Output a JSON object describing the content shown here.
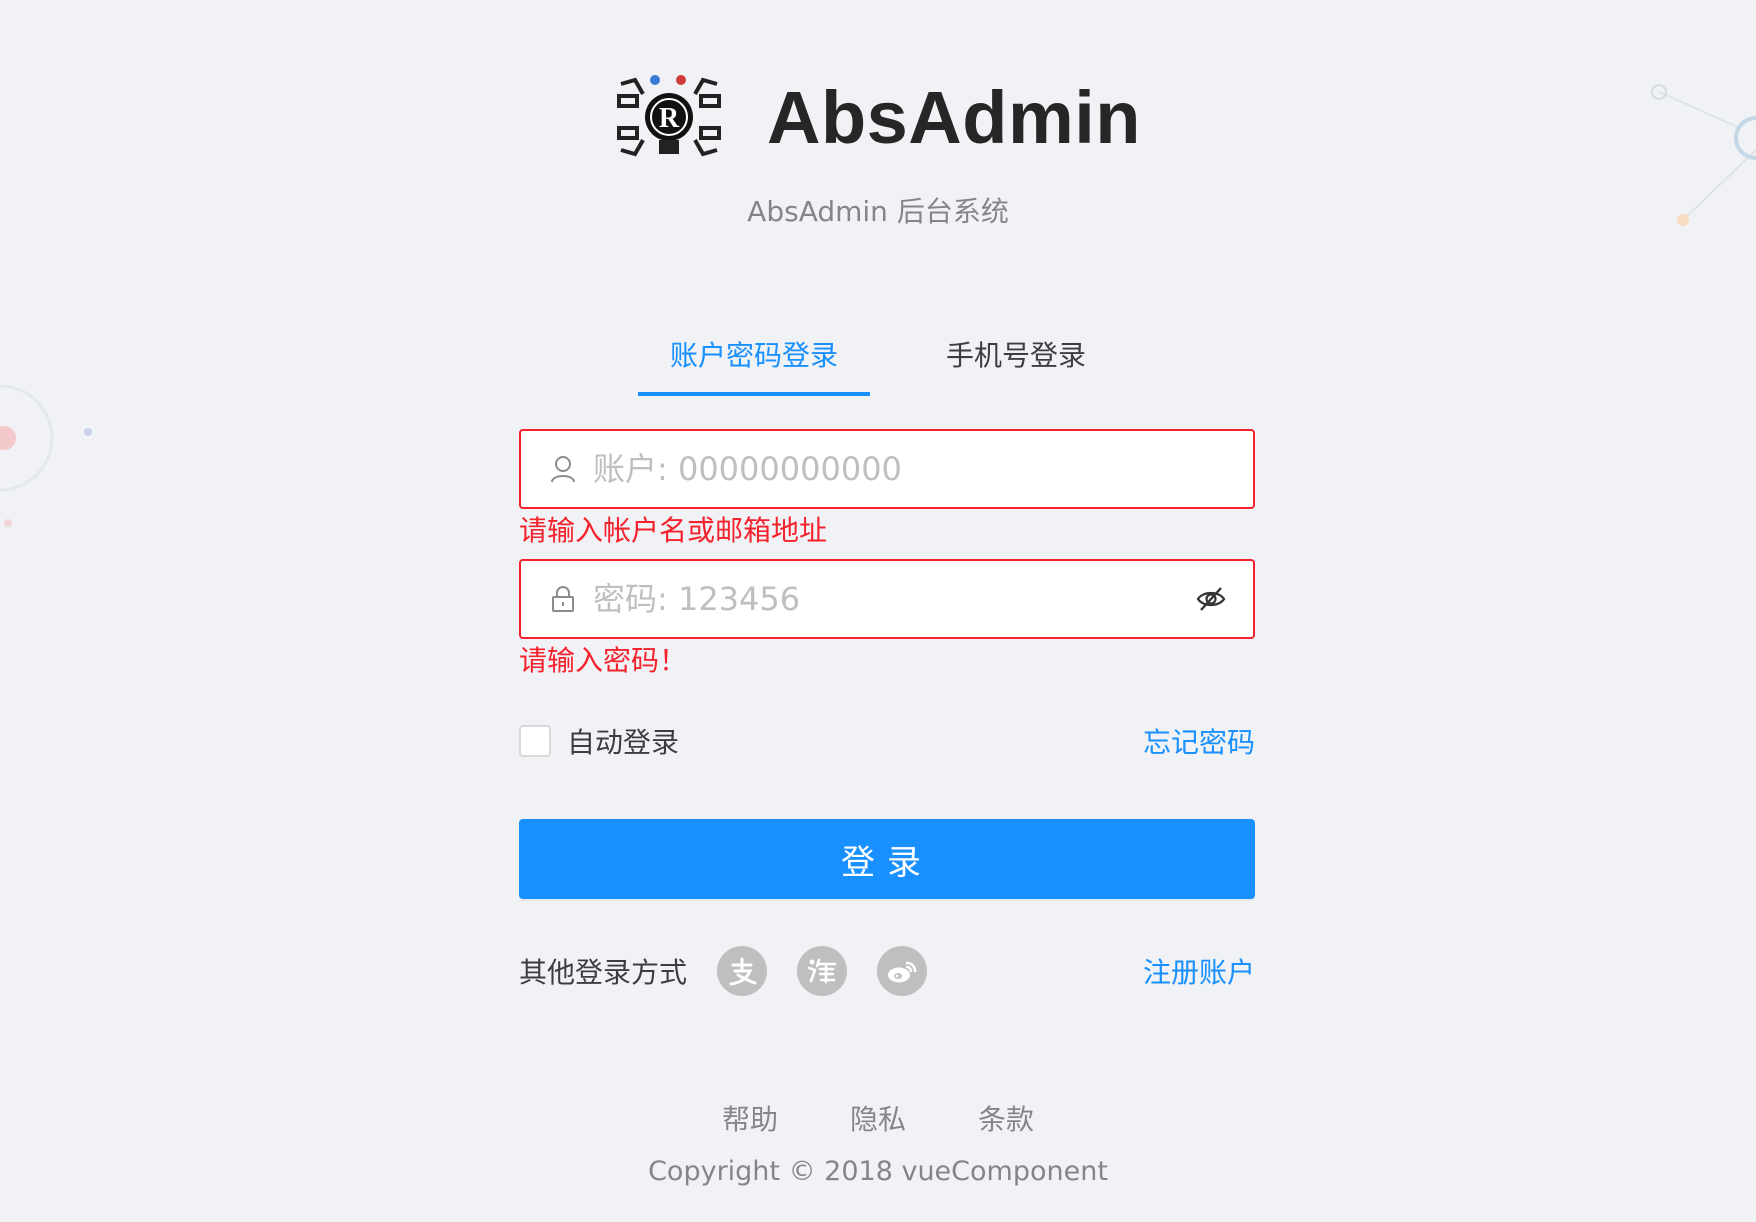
{
  "header": {
    "app_title": "AbsAdmin",
    "subtitle": "AbsAdmin 后台系统",
    "logo_text": "R"
  },
  "tabs": [
    {
      "label": "账户密码登录",
      "active": true
    },
    {
      "label": "手机号登录",
      "active": false
    }
  ],
  "form": {
    "account_placeholder": "账户: 00000000000",
    "account_value": "",
    "account_error": "请输入帐户名或邮箱地址",
    "password_placeholder": "密码: 123456",
    "password_value": "",
    "password_error": "请输入密码！",
    "remember_label": "自动登录",
    "remember_checked": false,
    "forgot_label": "忘记密码",
    "submit_label": "登录",
    "other_login_label": "其他登录方式",
    "social_icons": [
      "alipay-icon",
      "taobao-icon",
      "weibo-icon"
    ],
    "register_label": "注册账户"
  },
  "footer": {
    "links": [
      "帮助",
      "隐私",
      "条款"
    ],
    "copyright": "Copyright © 2018 vueComponent"
  },
  "colors": {
    "primary": "#1890ff",
    "error": "#f5222d",
    "background": "#f0f2f5",
    "icon_gray": "#bfbfbf"
  }
}
